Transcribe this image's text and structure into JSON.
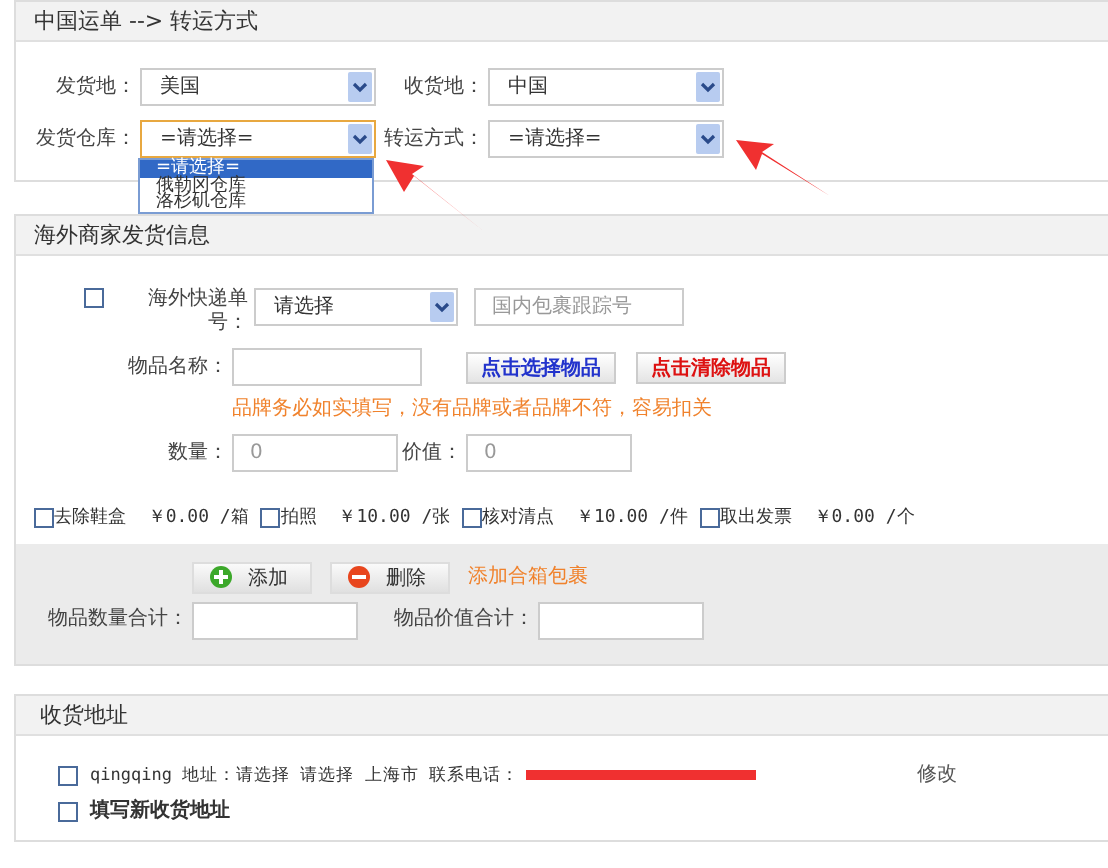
{
  "route_panel": {
    "title": "中国运单 --> 转运方式",
    "fields": [
      {
        "label": "发货地：",
        "value": "美国",
        "focused": false
      },
      {
        "label": "收货地：",
        "value": "中国",
        "focused": false
      },
      {
        "label": "发货仓库：",
        "value": "=请选择=",
        "focused": true
      },
      {
        "label": "转运方式：",
        "value": "=请选择=",
        "focused": false
      }
    ],
    "dropdown_options": [
      {
        "label": "=请选择=",
        "selected": true
      },
      {
        "label": "俄勒冈仓库",
        "selected": false
      },
      {
        "label": "洛杉矶仓库",
        "selected": false
      }
    ]
  },
  "merchant_panel": {
    "title": "海外商家发货信息",
    "tracking": {
      "checked": false,
      "label": "海外快递单号：",
      "select_value": "请选择",
      "placeholder": "国内包裹跟踪号"
    },
    "item_name": {
      "label": "物品名称："
    },
    "item_buttons": [
      {
        "label": "点击选择物品",
        "kind": "select"
      },
      {
        "label": "点击清除物品",
        "kind": "clear"
      }
    ],
    "warning": "品牌务必如实填写，没有品牌或者品牌不符，容易扣关",
    "quantity": {
      "label": "数量：",
      "placeholder": "0"
    },
    "value": {
      "label": "价值：",
      "placeholder": "0"
    },
    "services": [
      {
        "label": "去除鞋盒",
        "price": "￥0.00 /箱",
        "checked": false
      },
      {
        "label": "拍照",
        "price": "￥10.00 /张",
        "checked": false
      },
      {
        "label": "核对清点",
        "price": "￥10.00 /件",
        "checked": false
      },
      {
        "label": "取出发票",
        "price": "￥0.00 /个",
        "checked": false
      }
    ],
    "actions": [
      {
        "label": "添加",
        "kind": "add"
      },
      {
        "label": "删除",
        "kind": "remove"
      }
    ],
    "merge_link": "添加合箱包裹",
    "totals": [
      {
        "label": "物品数量合计："
      },
      {
        "label": "物品价值合计："
      }
    ]
  },
  "address_panel": {
    "title": "收货地址",
    "addresses": [
      {
        "text": "qingqing 地址：请选择 请选择 上海市 联系电话：",
        "redacted": true,
        "edit": "修改",
        "checked": false
      }
    ],
    "new_address": {
      "label": "填写新收货地址",
      "checked": false
    }
  }
}
